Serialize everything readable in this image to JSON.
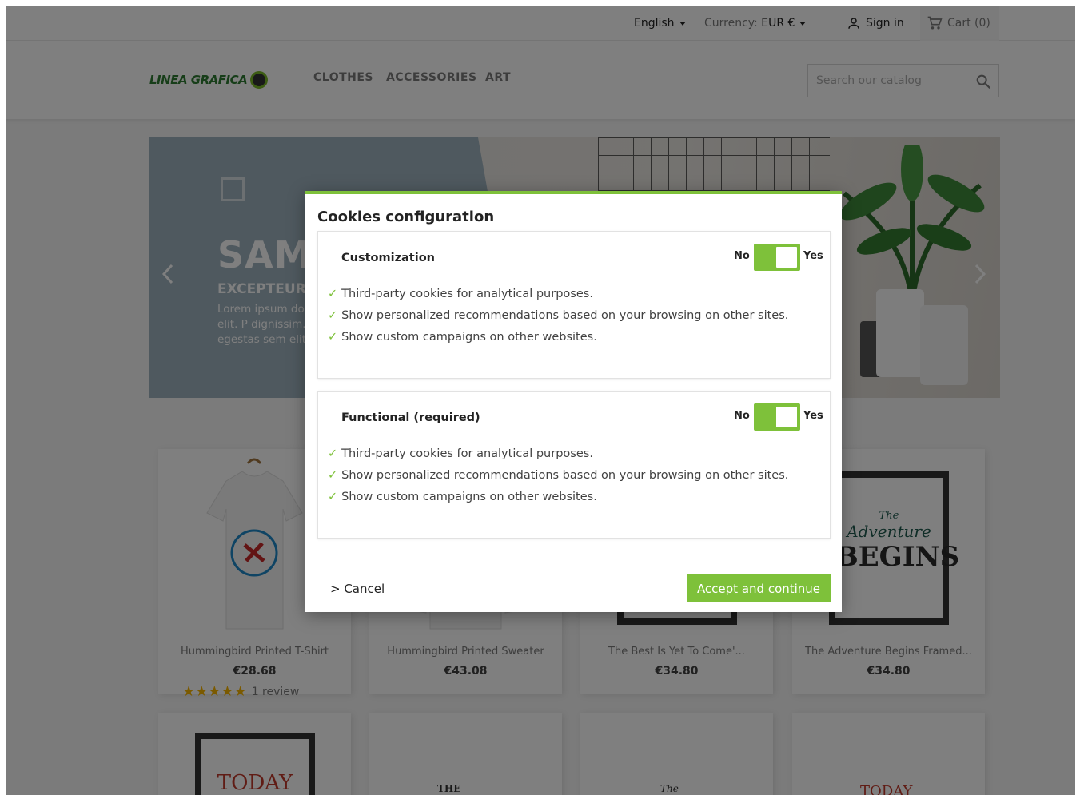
{
  "header": {
    "language": "English",
    "currency_label": "Currency:",
    "currency_value": "EUR €",
    "sign_in": "Sign in",
    "cart": "Cart (0)"
  },
  "brand": {
    "logo_text": "LINEA GRAFICA"
  },
  "menu": {
    "clothes": "CLOTHES",
    "accessories": "ACCESSORIES",
    "art": "ART"
  },
  "search": {
    "placeholder": "Search our catalog"
  },
  "banner": {
    "title": "SAM",
    "subtitle": "EXCEPTEUR C",
    "text": "Lorem ipsum do adipiscing elit. P dignissim. Quisc egestas sem elit"
  },
  "products": [
    {
      "name": "Hummingbird Printed T-Shirt",
      "price": "€28.68",
      "rating": 5,
      "reviews": "1 review"
    },
    {
      "name": "Hummingbird Printed Sweater",
      "price": "€43.08"
    },
    {
      "name": "The Best Is Yet To Come'...",
      "price": "€34.80"
    },
    {
      "name": "The Adventure Begins Framed...",
      "price": "€34.80"
    }
  ],
  "poster_text": {
    "p4_line1": "The",
    "p4_line2": "Adventure",
    "p4_line3": "BEGINS",
    "p5": "TODAY",
    "p6": "THE",
    "p7": "The",
    "p8": "TODAY"
  },
  "modal": {
    "title": "Cookies configuration",
    "sections": [
      {
        "title": "Customization",
        "toggle_no": "No",
        "toggle_yes": "Yes",
        "enabled": true,
        "features": [
          "Third-party cookies for analytical purposes.",
          "Show personalized recommendations based on your browsing on other sites.",
          "Show custom campaigns on other websites."
        ]
      },
      {
        "title": "Functional (required)",
        "toggle_no": "No",
        "toggle_yes": "Yes",
        "enabled": true,
        "features": [
          "Third-party cookies for analytical purposes.",
          "Show personalized recommendations based on your browsing on other sites.",
          "Show custom campaigns on other websites."
        ]
      }
    ],
    "check_glyph": "✓",
    "cancel": "> Cancel",
    "accept": "Accept and continue"
  },
  "colors": {
    "accent": "#7ec13a",
    "overlay": "rgba(0,0,0,0.5)"
  },
  "icons": [
    "user-icon",
    "cart-icon",
    "search-icon",
    "chevron-left-icon",
    "chevron-right-icon",
    "checkmark-icon",
    "star-icon"
  ]
}
